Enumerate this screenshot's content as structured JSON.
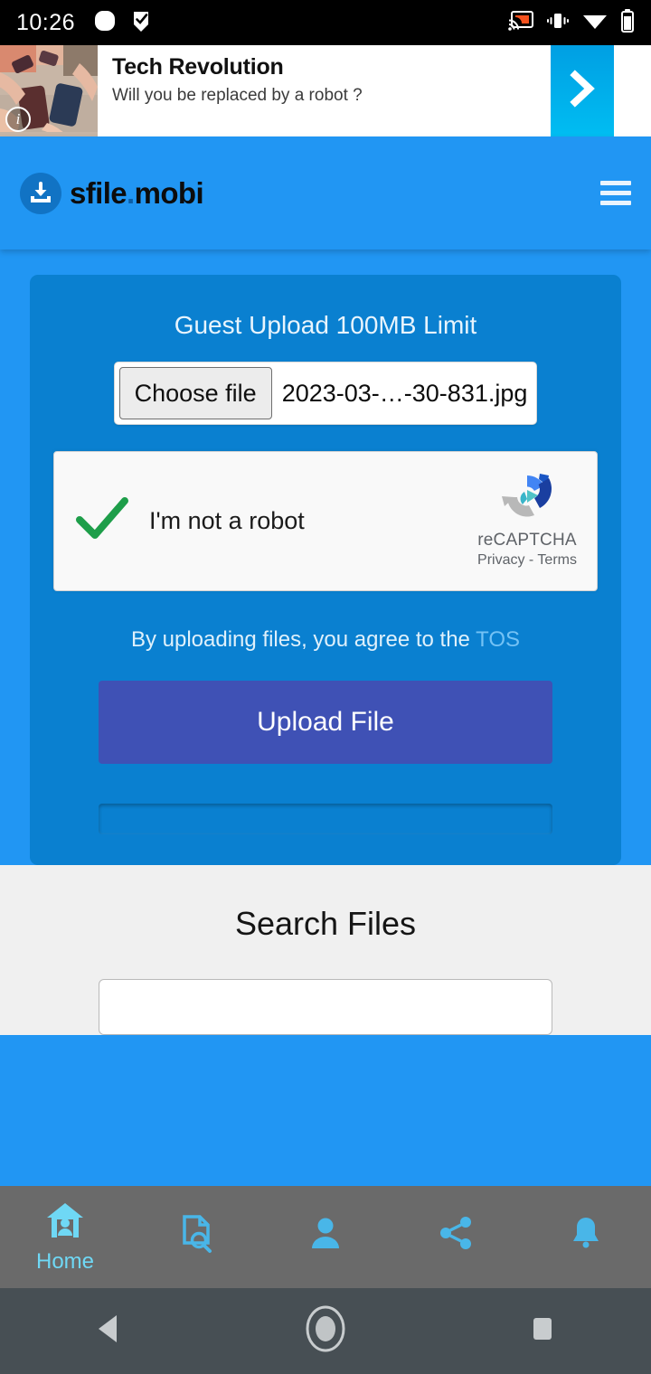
{
  "statusbar": {
    "time": "10:26",
    "left_icons": [
      "rounded-square-icon",
      "flag-check-icon"
    ],
    "right_icons": [
      "cast-icon",
      "vibrate-icon",
      "wifi-icon",
      "battery-icon"
    ]
  },
  "ad": {
    "title": "Tech Revolution",
    "subtitle": "Will you be replaced by a robot ?",
    "info_badge": "i",
    "cta_icon": "chevron-right-icon",
    "cta_color": "#00bdf2"
  },
  "header": {
    "logo_name": "sfile",
    "logo_dot": ".",
    "logo_suffix": "mobi",
    "logo_icon": "download-icon",
    "menu_icon": "hamburger-menu-icon",
    "bg_color": "#2196f3"
  },
  "upload": {
    "title": "Guest Upload 100MB Limit",
    "choose_file_label": "Choose file",
    "file_name": "2023-03-…-30-831.jpg",
    "captcha": {
      "label": "I'm not a robot",
      "checked": true,
      "check_color": "#1e9e4a",
      "brand": "reCAPTCHA",
      "legal": "Privacy - Terms"
    },
    "tos_text": "By uploading files, you agree to the ",
    "tos_link": "TOS",
    "submit_label": "Upload File",
    "submit_color": "#3f51b5",
    "progress_value": 0,
    "card_color": "#0a80d0"
  },
  "search": {
    "title": "Search Files",
    "placeholder": "",
    "value": ""
  },
  "tabbar": {
    "items": [
      {
        "name": "home",
        "icon": "home-person-icon",
        "label": "Home",
        "active": true
      },
      {
        "name": "files",
        "icon": "document-search-icon",
        "label": "",
        "active": false
      },
      {
        "name": "account",
        "icon": "person-icon",
        "label": "",
        "active": false
      },
      {
        "name": "share",
        "icon": "share-icon",
        "label": "",
        "active": false
      },
      {
        "name": "notifications",
        "icon": "bell-icon",
        "label": "",
        "active": false
      }
    ],
    "bg_color": "#6a6a6a",
    "icon_color": "#49b6e8",
    "active_color": "#6fd8f5"
  },
  "navbar": {
    "back": "back-triangle-icon",
    "home": "home-circle-icon",
    "recents": "recents-square-icon"
  }
}
